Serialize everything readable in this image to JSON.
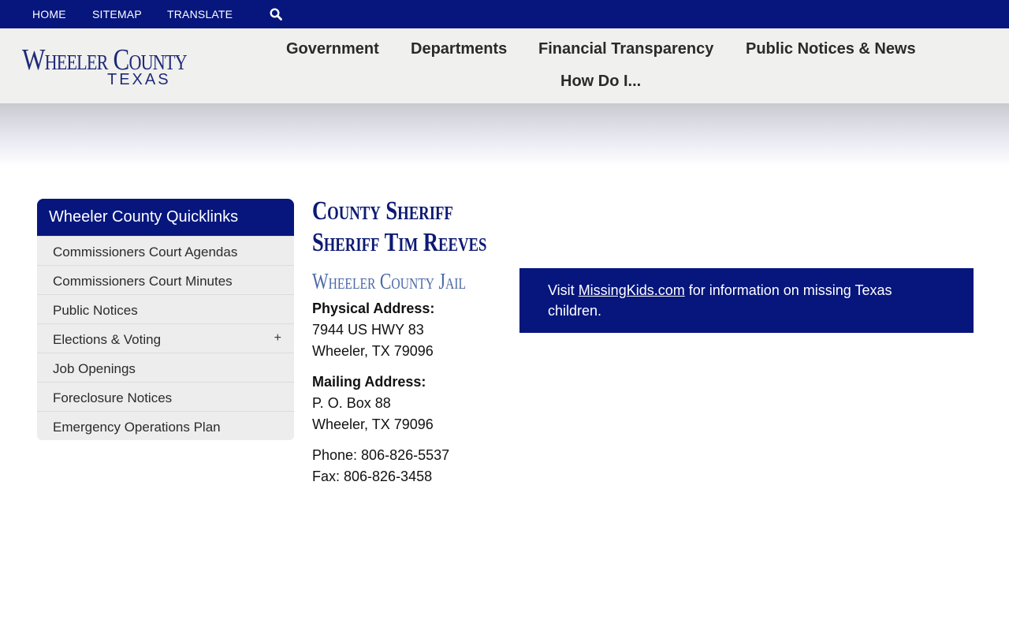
{
  "topbar": {
    "home": "HOME",
    "sitemap": "SITEMAP",
    "translate": "TRANSLATE",
    "search_icon": "search-icon"
  },
  "logo": {
    "main": "Wheeler County",
    "sub": "TEXAS"
  },
  "mainnav": {
    "government": "Government",
    "departments": "Departments",
    "financial": "Financial Transparency",
    "notices": "Public Notices & News",
    "howdoi": "How Do I..."
  },
  "sidebar": {
    "title": "Wheeler County Quicklinks",
    "items": [
      {
        "label": "Commissioners Court Agendas"
      },
      {
        "label": "Commissioners Court Minutes"
      },
      {
        "label": "Public Notices"
      },
      {
        "label": "Elections & Voting",
        "expand": "+"
      },
      {
        "label": "Job Openings"
      },
      {
        "label": "Foreclosure Notices"
      },
      {
        "label": "Emergency Operations Plan"
      }
    ]
  },
  "content": {
    "title_line1": "County Sheriff",
    "title_line2": "Sheriff Tim Reeves",
    "subtitle": "Wheeler County Jail",
    "physical_label": "Physical Address:",
    "physical_line1": "7944 US HWY 83",
    "physical_line2": "Wheeler, TX 79096",
    "mailing_label": "Mailing Address:",
    "mailing_line1": "P. O. Box 88",
    "mailing_line2": "Wheeler, TX 79096",
    "phone": "Phone: 806-826-5537",
    "fax": "Fax: 806-826-3458"
  },
  "notice": {
    "prefix": "Visit ",
    "link": "MissingKids.com",
    "suffix": " for information on missing Texas children."
  },
  "colors": {
    "navy": "#06167d",
    "header_bg": "#f0f0ee",
    "sidebar_bg": "#ededed",
    "subtitle": "#4b68a6"
  }
}
